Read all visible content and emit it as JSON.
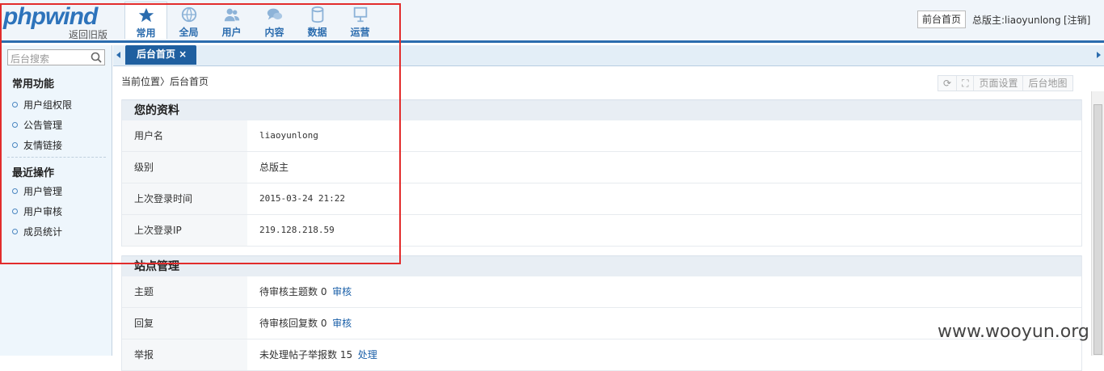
{
  "header": {
    "logo": "phpwind",
    "old_version": "返回旧版",
    "nav": [
      "常用",
      "全局",
      "用户",
      "内容",
      "数据",
      "运营"
    ],
    "front_button": "前台首页",
    "admin_label": "总版主:liaoyunlong",
    "logout": "[注销]"
  },
  "sidebar": {
    "search_placeholder": "后台搜索",
    "common_title": "常用功能",
    "common_items": [
      "用户组权限",
      "公告管理",
      "友情链接"
    ],
    "recent_title": "最近操作",
    "recent_items": [
      "用户管理",
      "用户审核",
      "成员统计"
    ]
  },
  "tabs": {
    "home": "后台首页 ×"
  },
  "breadcrumb": {
    "current": "当前位置",
    "sep": "〉",
    "page": "后台首页"
  },
  "toolbar": {
    "page_settings": "页面设置",
    "site_map": "后台地图"
  },
  "profile": {
    "title": "您的资料",
    "rows": [
      {
        "label": "用户名",
        "value": "liaoyunlong"
      },
      {
        "label": "级别",
        "value": "总版主"
      },
      {
        "label": "上次登录时间",
        "value": "2015-03-24 21:22"
      },
      {
        "label": "上次登录IP",
        "value": "219.128.218.59"
      }
    ]
  },
  "site": {
    "title": "站点管理",
    "rows": [
      {
        "label": "主题",
        "value": "待审核主题数 0",
        "link": "审核"
      },
      {
        "label": "回复",
        "value": "待审核回复数 0",
        "link": "审核"
      },
      {
        "label": "举报",
        "value": "未处理帖子举报数 15",
        "link": "处理"
      }
    ]
  },
  "watermark": "www.wooyun.org",
  "colors": {
    "brand": "#2d73bb",
    "highlight": "#e22c2c"
  }
}
